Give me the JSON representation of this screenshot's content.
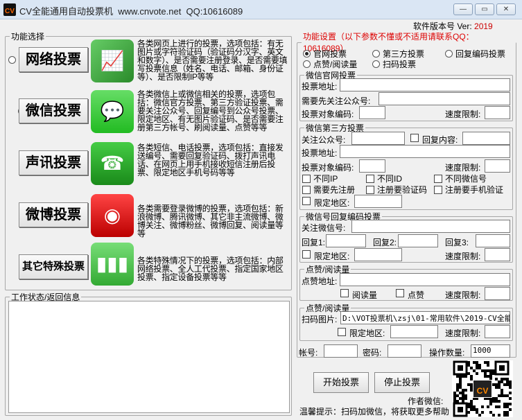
{
  "window": {
    "title": "CV全能通用自动投票机  www.cnvote.net  QQ:10616089",
    "logo_text": "CV",
    "controls": [
      "minimize",
      "maximize",
      "close"
    ]
  },
  "left": {
    "legend": "功能选择",
    "options": [
      {
        "label": "网络投票",
        "selected": false,
        "icon": "chart-growth-icon",
        "desc": "各类网页上进行的投票，选项包括：有无图片或字符验证码（验证码分汉字、英文和数字）、是否需要注册登录、是否需要填写投票信息（姓名、电话、邮箱、身份证等）、是否限制IP等等"
      },
      {
        "label": "微信投票",
        "selected": true,
        "icon": "wechat-icon",
        "desc": "各类微信上或微信相关的投票，选项包括：微信官方投票、第三方验证投票、需要关注公众号、回复编号到公众号投票、限定地区、有无图片验证码、是否需要注册第三方帐号、刷阅读量、点赞等等"
      },
      {
        "label": "声讯投票",
        "selected": false,
        "icon": "phone-contact-icon",
        "desc": "各类短信、电话投票，选项包括：直接发送编号、需要回复验证码、拨打声讯电话、在网页上用手机接收短信注册后投票、限定地区手机号码等等"
      },
      {
        "label": "微博投票",
        "selected": false,
        "icon": "weibo-icon",
        "desc": "各类需要登录微博的投票，选项包括：新浪微博、腾讯微博、其它非主流微博、微博关注、微博粉丝、微博回复、阅读量等等"
      },
      {
        "label": "其它特殊投票",
        "selected": false,
        "icon": "bar-chart-icon",
        "desc": "各类特殊情况下的投票，选项包括：内部网络投票、全人工代投票、指定国家地区投票、指定设备投票等等"
      }
    ]
  },
  "status": {
    "legend": "工作状态/返回信息",
    "text": ""
  },
  "right": {
    "version_label": "软件版本号 Ver:",
    "version": "2019",
    "legend": "功能设置（以下参数不懂或不适用请联系QQ：10616089）",
    "modes": [
      {
        "label": "官网投票",
        "selected": true
      },
      {
        "label": "第三方投票",
        "selected": false
      },
      {
        "label": "回复编码投票",
        "selected": false
      },
      {
        "label": "点赞/阅读量",
        "selected": false
      },
      {
        "label": "扫码投票",
        "selected": false
      }
    ],
    "official": {
      "legend": "微信官网投票",
      "url_label": "投票地址:",
      "follow_label": "需要先关注公众号:",
      "code_label": "投票对象编码:",
      "speed_label": "速度限制:"
    },
    "third": {
      "legend": "微信第三方投票",
      "follow_label": "关注公众号:",
      "reply_label": "回复内容:",
      "url_label": "投票地址:",
      "code_label": "投票对象编码:",
      "speed_label": "速度限制:",
      "checks": [
        "不同IP",
        "不同ID",
        "不同微信号",
        "需要先注册",
        "注册要验证码",
        "注册要手机验证"
      ],
      "region_label": "限定地区:"
    },
    "reply": {
      "legend": "微信号回复编码投票",
      "id_label": "关注微信号:",
      "r1": "回复1:",
      "r2": "回复2:",
      "r3": "回复3:",
      "region_label": "限定地区:",
      "speed_label": "速度限制:"
    },
    "like": {
      "legend": "点赞/阅读量",
      "url_label": "点赞地址:",
      "read_label": "阅读量",
      "like_label": "点赞",
      "speed_label": "速度限制:"
    },
    "scan": {
      "legend": "点赞/阅读量",
      "img_label": "扫码图片:",
      "img_value": "D:\\VOT投票机\\zsj\\01-常用软件\\2019-CV全能",
      "region_label": "限定地区:",
      "speed_label": "速度限制:"
    },
    "account_label": "帐号:",
    "password_label": "密码:",
    "count_label": "操作数量:",
    "count_value": "1000"
  },
  "actions": {
    "start": "开始投票",
    "stop": "停止投票"
  },
  "footer": {
    "author_label": "作者微信:",
    "hint": "温馨提示：扫码加微信，将获取更多帮助",
    "qr_logo": "CV"
  }
}
